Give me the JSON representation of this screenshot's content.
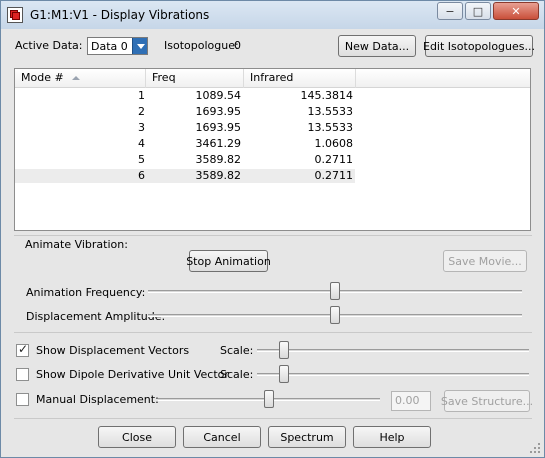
{
  "window": {
    "title": "G1:M1:V1 - Display Vibrations",
    "caption_buttons": {
      "minimize": "−",
      "maximize": "□",
      "close": "✕"
    }
  },
  "top": {
    "active_data_label": "Active Data:",
    "active_data_value": "Data 0",
    "isotopologue_label": "Isotopologue:",
    "isotopologue_value": "0",
    "new_data_button": "New Data...",
    "edit_isotopologues_button": "Edit Isotopologues..."
  },
  "table": {
    "headers": [
      "Mode #",
      "Freq",
      "Infrared"
    ],
    "rows": [
      {
        "mode": "1",
        "freq": "1089.54",
        "infrared": "145.3814"
      },
      {
        "mode": "2",
        "freq": "1693.95",
        "infrared": "13.5533"
      },
      {
        "mode": "3",
        "freq": "1693.95",
        "infrared": "13.5533"
      },
      {
        "mode": "4",
        "freq": "3461.29",
        "infrared": "1.0608"
      },
      {
        "mode": "5",
        "freq": "3589.82",
        "infrared": "0.2711"
      },
      {
        "mode": "6",
        "freq": "3589.82",
        "infrared": "0.2711"
      }
    ],
    "selected_row": 6
  },
  "animate": {
    "label": "Animate Vibration:",
    "stop_button": "Stop Animation",
    "save_movie_button": "Save Movie...",
    "frequency_label": "Animation Frequency:",
    "frequency_level": 0.5,
    "amplitude_label": "Displacement Amplitude:",
    "amplitude_level": 0.5
  },
  "options": {
    "show_vectors_label": "Show Displacement Vectors",
    "show_vectors_checked": true,
    "show_vectors_scale_label": "Scale:",
    "show_vectors_scale_level": 0.1,
    "dipole_label": "Show Dipole Derivative Unit Vector",
    "dipole_checked": false,
    "dipole_scale_label": "Scale:",
    "dipole_scale_level": 0.1,
    "manual_label": "Manual Displacement:",
    "manual_checked": false,
    "manual_value": "0.00",
    "manual_level": 0.5,
    "save_structure_button": "Save Structure..."
  },
  "footer": {
    "close_button": "Close",
    "cancel_button": "Cancel",
    "spectrum_button": "Spectrum",
    "help_button": "Help"
  }
}
